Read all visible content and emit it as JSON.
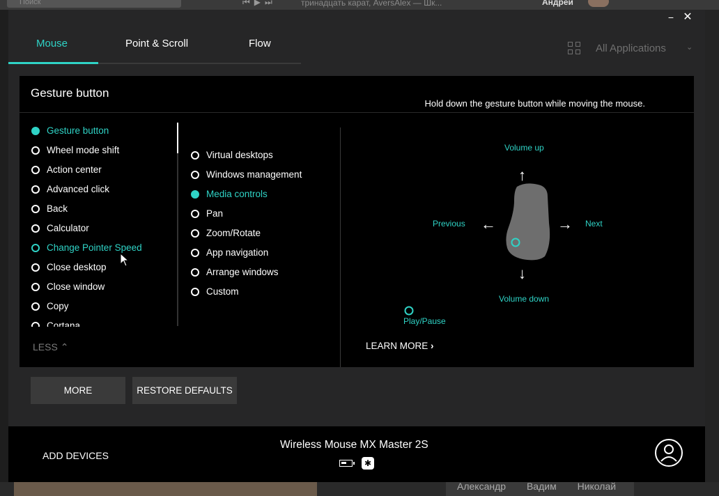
{
  "background": {
    "search_placeholder": "Поиск",
    "track": "тринадцать карат, AversAlex — Шк...",
    "user": "Андрей",
    "names": [
      "Александр",
      "Вадим",
      "Николай"
    ]
  },
  "window": {
    "minimize_icon": "−",
    "close_icon": "✕"
  },
  "tabs": [
    {
      "label": "Mouse",
      "active": true
    },
    {
      "label": "Point & Scroll",
      "active": false
    },
    {
      "label": "Flow",
      "active": false
    }
  ],
  "apps": {
    "label": "All Applications",
    "icon": "grid-icon"
  },
  "panel": {
    "title": "Gesture button",
    "hint": "Hold down the gesture button while moving the mouse.",
    "actions": [
      {
        "label": "Gesture button",
        "state": "selected"
      },
      {
        "label": "Wheel mode shift",
        "state": "normal"
      },
      {
        "label": "Action center",
        "state": "normal"
      },
      {
        "label": "Advanced click",
        "state": "normal"
      },
      {
        "label": "Back",
        "state": "normal"
      },
      {
        "label": "Calculator",
        "state": "normal"
      },
      {
        "label": "Change Pointer Speed",
        "state": "hover"
      },
      {
        "label": "Close desktop",
        "state": "normal"
      },
      {
        "label": "Close window",
        "state": "normal"
      },
      {
        "label": "Copy",
        "state": "normal"
      },
      {
        "label": "Cortana",
        "state": "normal"
      }
    ],
    "gesture_modes": [
      {
        "label": "Virtual desktops",
        "state": "normal"
      },
      {
        "label": "Windows management",
        "state": "normal"
      },
      {
        "label": "Media controls",
        "state": "selected"
      },
      {
        "label": "Pan",
        "state": "normal"
      },
      {
        "label": "Zoom/Rotate",
        "state": "normal"
      },
      {
        "label": "App navigation",
        "state": "normal"
      },
      {
        "label": "Arrange windows",
        "state": "normal"
      },
      {
        "label": "Custom",
        "state": "normal"
      }
    ],
    "less_label": "LESS",
    "learn_more_label": "LEARN MORE",
    "diagram": {
      "up": "Volume up",
      "down": "Volume down",
      "left": "Previous",
      "right": "Next",
      "click": "Play/Pause"
    }
  },
  "buttons": {
    "more": "MORE",
    "restore": "RESTORE DEFAULTS"
  },
  "footer": {
    "add_devices": "ADD DEVICES",
    "device_name": "Wireless Mouse MX Master 2S"
  },
  "colors": {
    "accent": "#2fd3c6",
    "background": "#262627",
    "panel": "#000000"
  }
}
